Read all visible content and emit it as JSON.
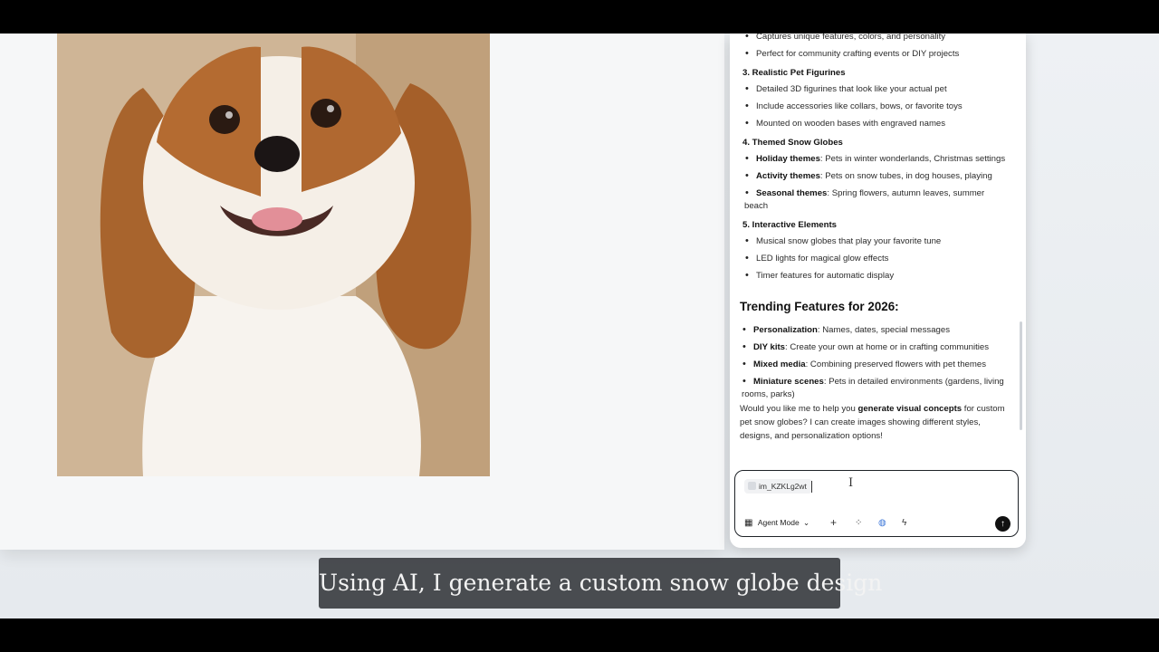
{
  "chat": {
    "top_items": [
      "Captures unique features, colors, and personality",
      "Perfect for community crafting events or DIY projects"
    ],
    "section3": {
      "title": "3. Realistic Pet Figurines",
      "items": [
        "Detailed 3D figurines that look like your actual pet",
        "Include accessories like collars, bows, or favorite toys",
        "Mounted on wooden bases with engraved names"
      ]
    },
    "section4": {
      "title": "4. Themed Snow Globes",
      "items": [
        {
          "label": "Holiday themes",
          "text": ": Pets in winter wonderlands, Christmas settings"
        },
        {
          "label": "Activity themes",
          "text": ": Pets on snow tubes, in dog houses, playing"
        },
        {
          "label": "Seasonal themes",
          "text": ": Spring flowers, autumn leaves, summer",
          "cont": "beach"
        }
      ]
    },
    "section5": {
      "title": "5. Interactive Elements",
      "items": [
        "Musical snow globes that play your favorite tune",
        "LED lights for magical glow effects",
        "Timer features for automatic display"
      ]
    },
    "trending": {
      "title": "Trending Features for 2026:",
      "items": [
        {
          "label": "Personalization",
          "text": ": Names, dates, special messages"
        },
        {
          "label": "DIY kits",
          "text": ": Create your own at home or in crafting communities"
        },
        {
          "label": "Mixed media",
          "text": ": Combining preserved flowers with pet themes"
        },
        {
          "label": "Miniature scenes",
          "text": ": Pets in detailed environments (gardens, living",
          "cont": "rooms, parks)"
        }
      ]
    },
    "closing": {
      "pre": "Would you like me to help you ",
      "bold": "generate visual concepts",
      "line1_rest": " for custom",
      "line2": "pet snow globes? I can create images showing different styles,",
      "line3": "designs, and personalization options!"
    }
  },
  "input": {
    "chip_label": "im_KZKLg2wt"
  },
  "toolbar": {
    "mode_label": "Agent Mode",
    "icons": [
      "grid-icon",
      "chevron-down-icon",
      "plus-icon",
      "apps-icon",
      "globe-icon",
      "lightning-icon",
      "send-icon"
    ]
  },
  "caption": {
    "text": "Using AI, I generate a custom snow globe design"
  }
}
